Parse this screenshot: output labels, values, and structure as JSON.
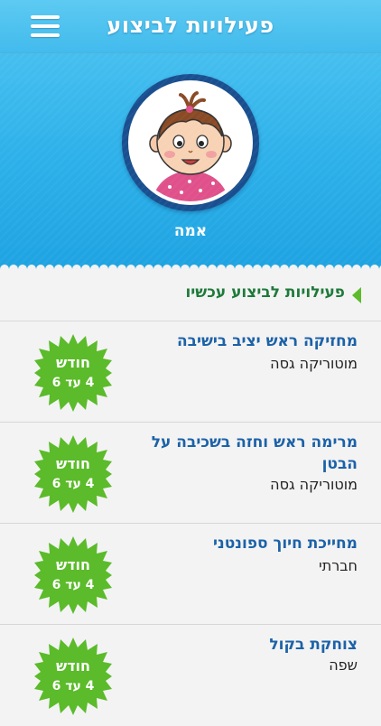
{
  "navbar": {
    "title": "פעילויות לביצוע",
    "menu_icon": "hamburger-menu-icon"
  },
  "profile": {
    "child_name": "אמה",
    "avatar_icon": "child-avatar-icon"
  },
  "section": {
    "title": "פעילויות לביצוע עכשיו",
    "arrow_icon": "triangle-left-icon"
  },
  "colors": {
    "header_blue": "#2fb2ea",
    "accent_green": "#5bbb2a",
    "title_blue": "#1c62a8"
  },
  "activities": [
    {
      "title": "מחזיקה ראש יציב בישיבה",
      "category": "מוטוריקה גסה",
      "badge_unit": "חודש",
      "badge_range": "4 עד 6"
    },
    {
      "title": "מרימה ראש וחזה בשכיבה על הבטן",
      "category": "מוטוריקה גסה",
      "badge_unit": "חודש",
      "badge_range": "4 עד 6"
    },
    {
      "title": "מחייכת חיוך ספונטני",
      "category": "חברתי",
      "badge_unit": "חודש",
      "badge_range": "4 עד 6"
    },
    {
      "title": "צוחקת בקול",
      "category": "שפה",
      "badge_unit": "חודש",
      "badge_range": "4 עד 6"
    }
  ]
}
